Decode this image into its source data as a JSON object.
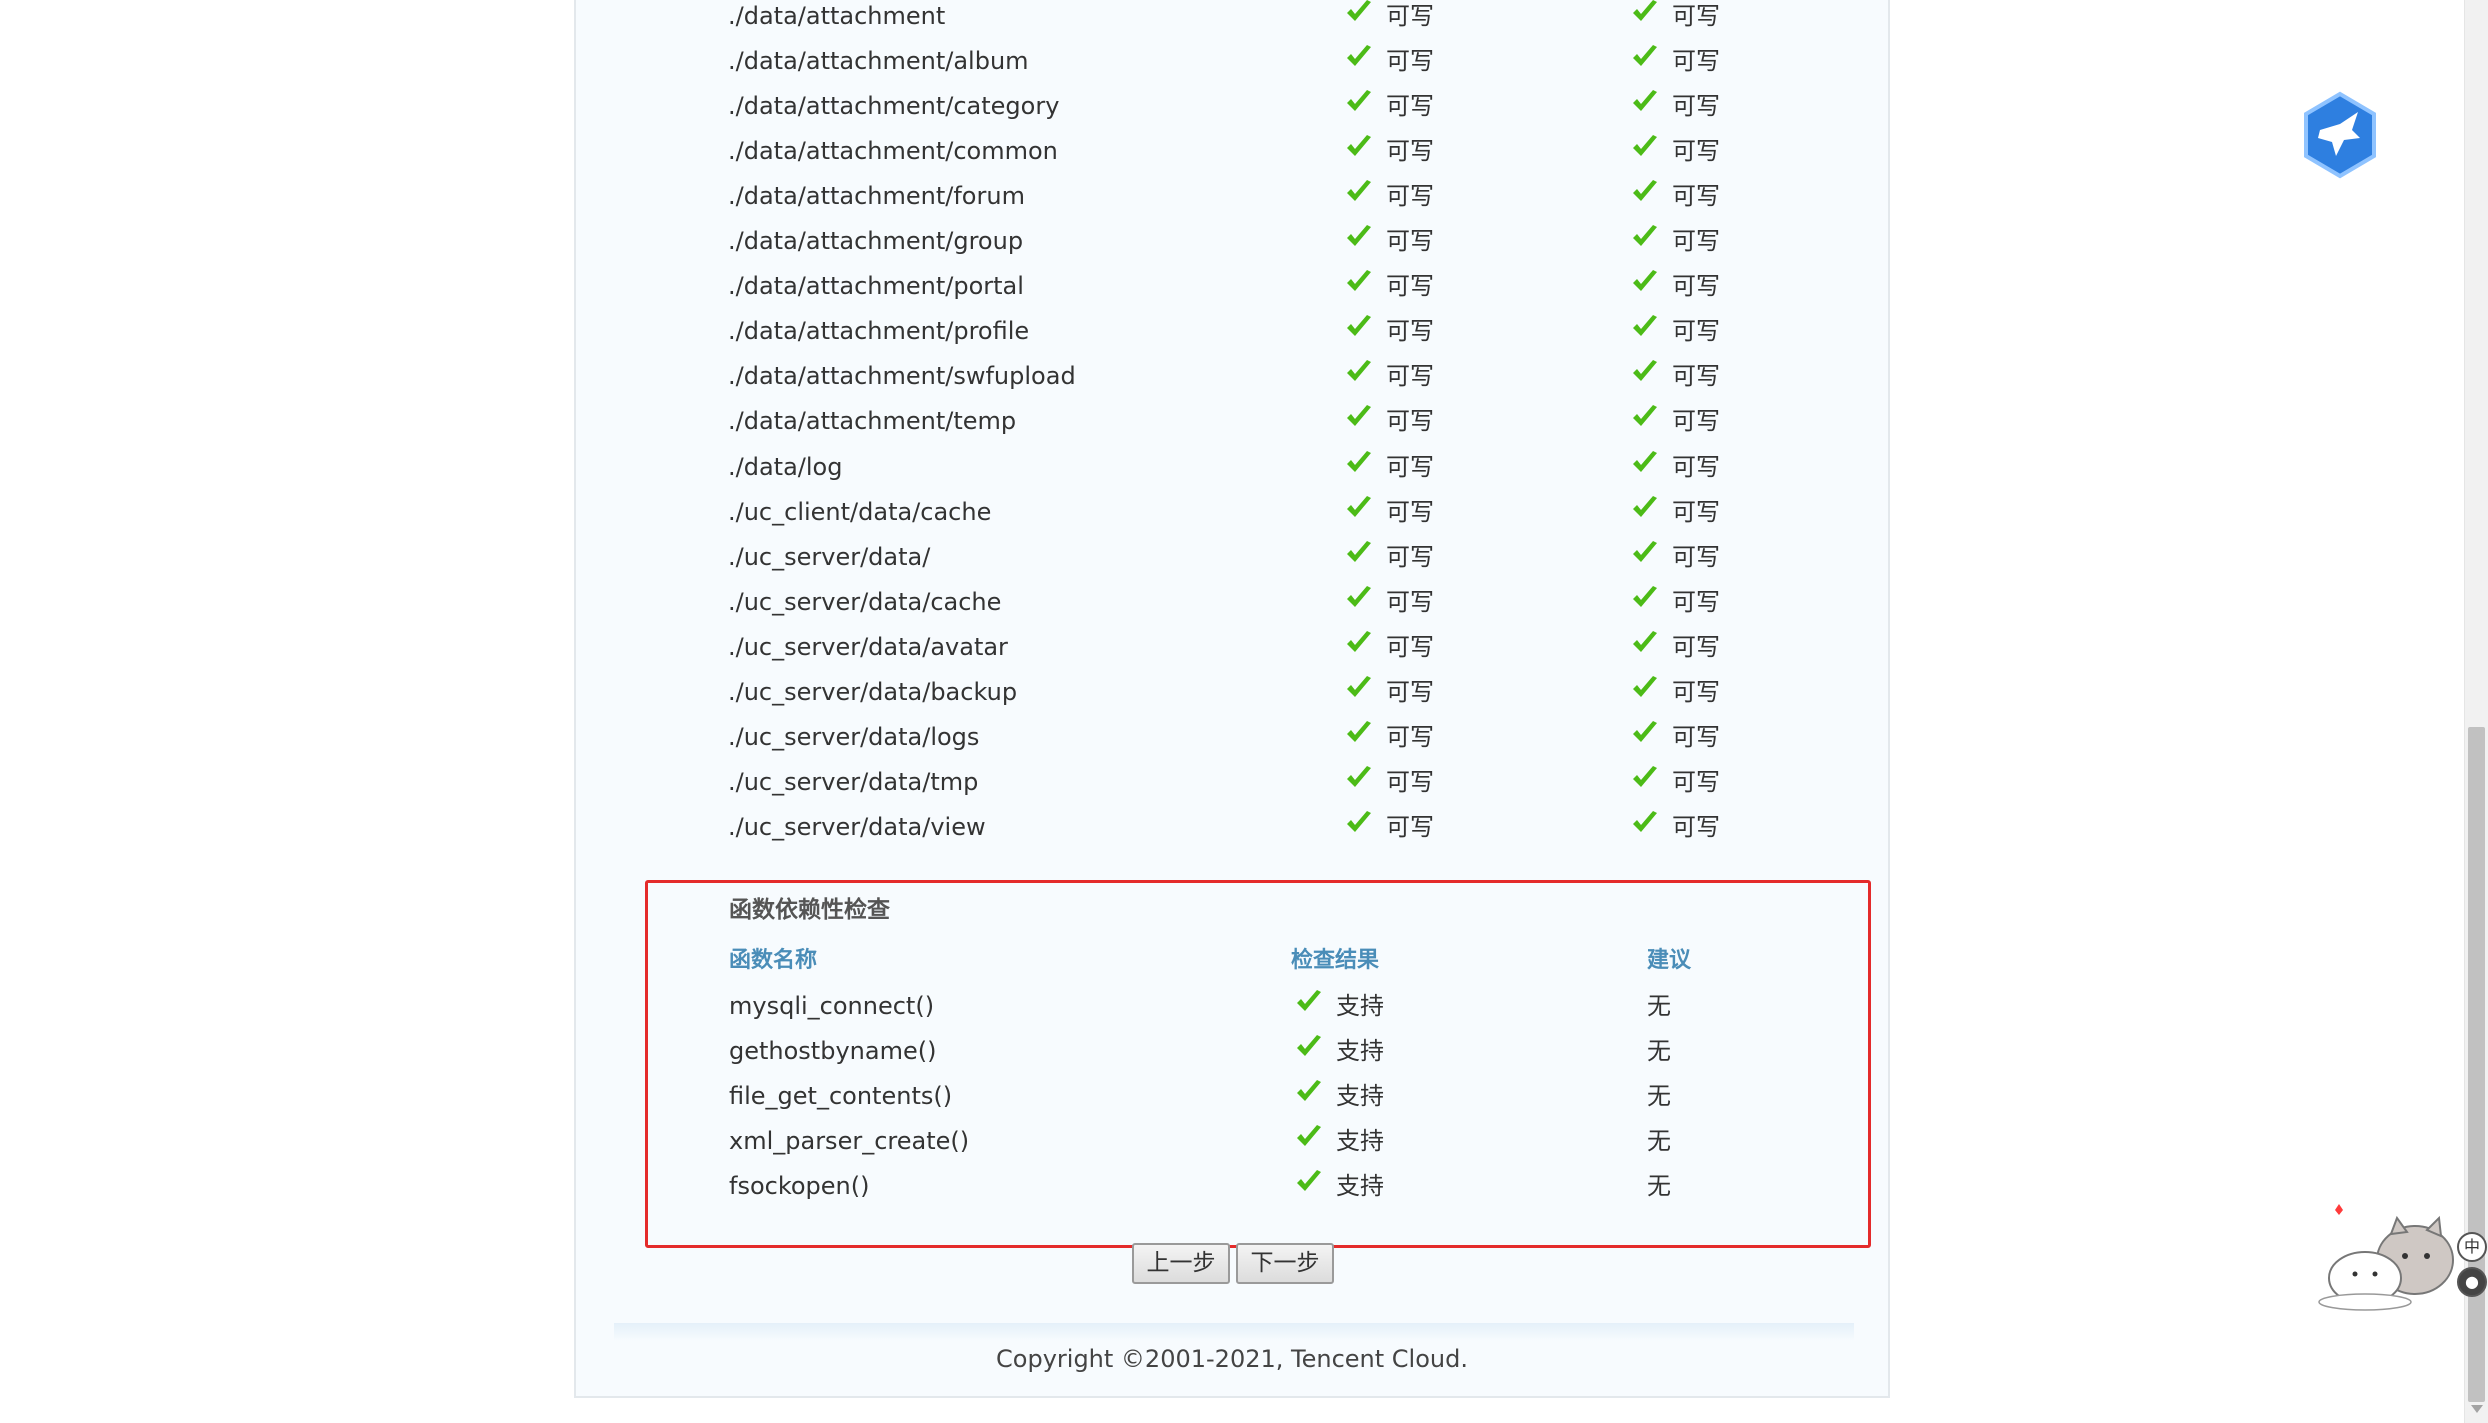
{
  "directory_rows": [
    {
      "path": "./data/attachment",
      "current": "可写",
      "required": "可写"
    },
    {
      "path": "./data/attachment/album",
      "current": "可写",
      "required": "可写"
    },
    {
      "path": "./data/attachment/category",
      "current": "可写",
      "required": "可写"
    },
    {
      "path": "./data/attachment/common",
      "current": "可写",
      "required": "可写"
    },
    {
      "path": "./data/attachment/forum",
      "current": "可写",
      "required": "可写"
    },
    {
      "path": "./data/attachment/group",
      "current": "可写",
      "required": "可写"
    },
    {
      "path": "./data/attachment/portal",
      "current": "可写",
      "required": "可写"
    },
    {
      "path": "./data/attachment/profile",
      "current": "可写",
      "required": "可写"
    },
    {
      "path": "./data/attachment/swfupload",
      "current": "可写",
      "required": "可写"
    },
    {
      "path": "./data/attachment/temp",
      "current": "可写",
      "required": "可写"
    },
    {
      "path": "./data/log",
      "current": "可写",
      "required": "可写"
    },
    {
      "path": "./uc_client/data/cache",
      "current": "可写",
      "required": "可写"
    },
    {
      "path": "./uc_server/data/",
      "current": "可写",
      "required": "可写"
    },
    {
      "path": "./uc_server/data/cache",
      "current": "可写",
      "required": "可写"
    },
    {
      "path": "./uc_server/data/avatar",
      "current": "可写",
      "required": "可写"
    },
    {
      "path": "./uc_server/data/backup",
      "current": "可写",
      "required": "可写"
    },
    {
      "path": "./uc_server/data/logs",
      "current": "可写",
      "required": "可写"
    },
    {
      "path": "./uc_server/data/tmp",
      "current": "可写",
      "required": "可写"
    },
    {
      "path": "./uc_server/data/view",
      "current": "可写",
      "required": "可写"
    }
  ],
  "function_check": {
    "title": "函数依赖性检查",
    "headers": {
      "name": "函数名称",
      "result": "检查结果",
      "advice": "建议"
    },
    "rows": [
      {
        "name": "mysqli_connect()",
        "result": "支持",
        "advice": "无"
      },
      {
        "name": "gethostbyname()",
        "result": "支持",
        "advice": "无"
      },
      {
        "name": "file_get_contents()",
        "result": "支持",
        "advice": "无"
      },
      {
        "name": "xml_parser_create()",
        "result": "支持",
        "advice": "无"
      },
      {
        "name": "fsockopen()",
        "result": "支持",
        "advice": "无"
      }
    ]
  },
  "buttons": {
    "prev": "上一步",
    "next": "下一步"
  },
  "footer": {
    "copyright": "Copyright ©2001-2021, Tencent Cloud."
  },
  "widgets": {
    "lang_toggle": "中"
  },
  "colors": {
    "check": "#4cbb17",
    "highlight_border": "#e42b2b",
    "header_text": "#4a8db8",
    "badge_blue": "#2e7fe0"
  }
}
